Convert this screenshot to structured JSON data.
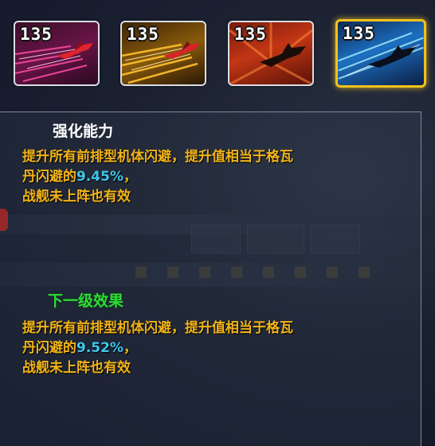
{
  "skills": [
    {
      "level": "135",
      "theme": "magenta-streaks",
      "icon": "fighter-ship-icon",
      "selected": false
    },
    {
      "level": "135",
      "theme": "gold-streaks",
      "icon": "fighter-ship-icon",
      "selected": false
    },
    {
      "level": "135",
      "theme": "orange-silhouette",
      "icon": "fighter-ship-icon",
      "selected": false
    },
    {
      "level": "135",
      "theme": "blue-silhouette",
      "icon": "fighter-ship-icon",
      "selected": true
    }
  ],
  "current": {
    "title": "强化能力",
    "line1": "提升所有前排型机体闪避，提升值相当于格瓦",
    "line2_prefix": "丹闪避的",
    "value": "9.45%",
    "line2_suffix": "，",
    "line3": "战舰未上阵也有效"
  },
  "next": {
    "title": "下一级效果",
    "line1": "提升所有前排型机体闪避，提升值相当于格瓦",
    "line2_prefix": "丹闪避的",
    "value": "9.52%",
    "line2_suffix": "，",
    "line3": "战舰未上阵也有效"
  },
  "colors": {
    "description": "#f3b416",
    "percent": "#3fc6e9",
    "next_heading": "#2edc37",
    "selected_border": "#f2c21c"
  }
}
